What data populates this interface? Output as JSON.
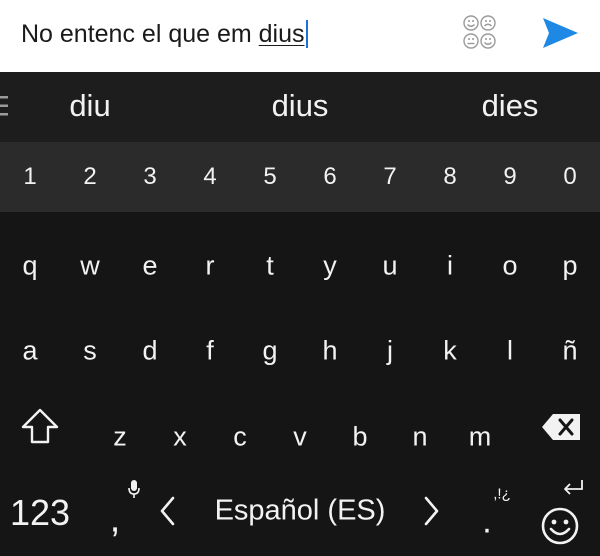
{
  "compose": {
    "text_before": "No entenc el que em ",
    "current_word": "dius",
    "emoji_icon": "emoji-faces-icon",
    "send_icon": "send-arrow-icon",
    "accent_color": "#1e88e5"
  },
  "suggestions": {
    "menu_icon": "menu-icon",
    "items": [
      "diu",
      "dius",
      "dies"
    ]
  },
  "number_row": [
    "1",
    "2",
    "3",
    "4",
    "5",
    "6",
    "7",
    "8",
    "9",
    "0"
  ],
  "row1": [
    "q",
    "w",
    "e",
    "r",
    "t",
    "y",
    "u",
    "i",
    "o",
    "p"
  ],
  "row2": [
    "a",
    "s",
    "d",
    "f",
    "g",
    "h",
    "j",
    "k",
    "l",
    "ñ"
  ],
  "row3": [
    "z",
    "x",
    "c",
    "v",
    "b",
    "n",
    "m"
  ],
  "bottom": {
    "symbols_label": "123",
    "comma_label": ",",
    "space_label": "Español (ES)",
    "period_label": ".",
    "punctuation_hint": ",!¿",
    "icons": [
      "shift-icon",
      "backspace-icon",
      "microphone-icon",
      "chevron-left-icon",
      "chevron-right-icon",
      "enter-icon",
      "emoji-icon"
    ]
  }
}
